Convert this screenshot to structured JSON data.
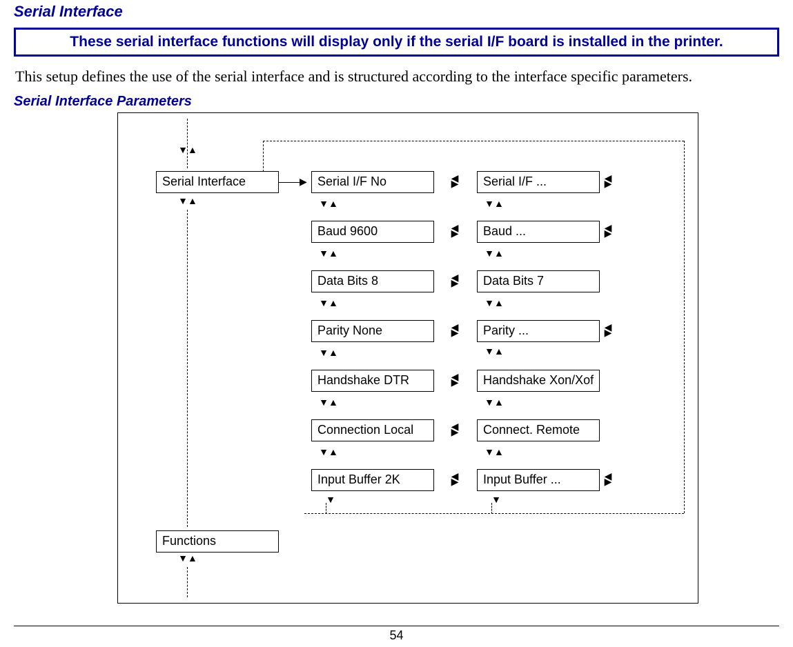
{
  "heading": "Serial Interface",
  "notice": "These serial interface functions will display only if the serial I/F board is installed in the printer.",
  "body": "This setup defines the use of the serial interface and is structured according to the interface specific parameters.",
  "subheading": "Serial Interface Parameters",
  "diagram": {
    "root": "Serial Interface",
    "functions": "Functions",
    "left": {
      "serial_if": "Serial I/F No",
      "baud": "Baud 9600",
      "data_bits": "Data Bits 8",
      "parity": "Parity None",
      "handshake": "Handshake DTR",
      "connection": "Connection Local",
      "input_buffer": "Input Buffer 2K"
    },
    "right": {
      "serial_if": "Serial I/F ...",
      "baud": "Baud ...",
      "data_bits": "Data Bits 7",
      "parity": "Parity  ...",
      "handshake": "Handshake Xon/Xof",
      "connection": "Connect. Remote",
      "input_buffer": "Input Buffer ..."
    }
  },
  "page_number": "54"
}
